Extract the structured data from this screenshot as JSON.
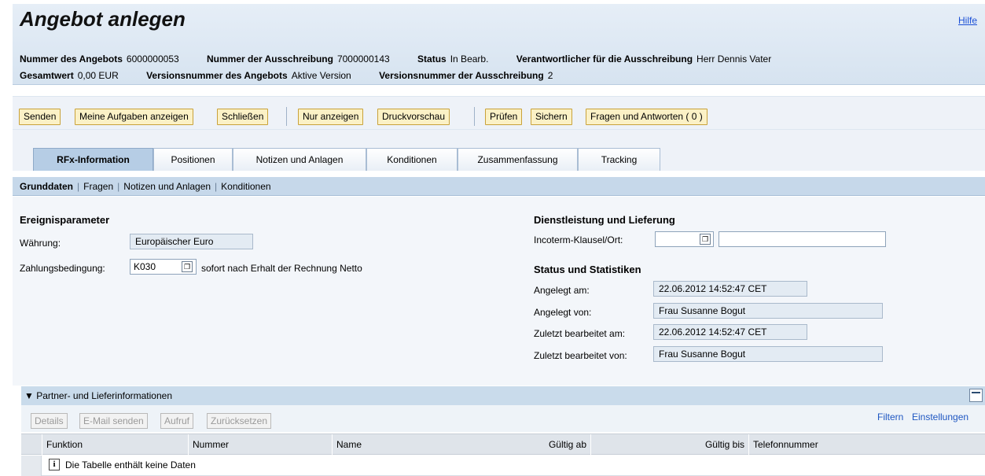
{
  "header": {
    "title": "Angebot anlegen",
    "help": "Hilfe",
    "row1": [
      {
        "label": "Nummer des Angebots",
        "value": "6000000053"
      },
      {
        "label": "Nummer der Ausschreibung",
        "value": "7000000143"
      },
      {
        "label": "Status",
        "value": "In Bearb."
      },
      {
        "label": "Verantwortlicher für die Ausschreibung",
        "value": "Herr Dennis Vater"
      }
    ],
    "row2": [
      {
        "label": "Gesamtwert",
        "value": "0,00 EUR"
      },
      {
        "label": "Versionsnummer des Angebots",
        "value": "Aktive Version"
      },
      {
        "label": "Versionsnummer der Ausschreibung",
        "value": "2"
      }
    ]
  },
  "toolbar": {
    "senden": "Senden",
    "aufgaben": "Meine Aufgaben anzeigen",
    "schliessen": "Schließen",
    "nur_anzeigen": "Nur anzeigen",
    "druckvorschau": "Druckvorschau",
    "pruefen": "Prüfen",
    "sichern": "Sichern",
    "fragen": "Fragen und Antworten ( 0 )"
  },
  "tabs": [
    {
      "label": "RFx-Information",
      "active": true
    },
    {
      "label": "Positionen"
    },
    {
      "label": "Notizen und Anlagen"
    },
    {
      "label": "Konditionen"
    },
    {
      "label": "Zusammenfassung"
    },
    {
      "label": "Tracking"
    }
  ],
  "subnav": [
    "Grunddaten",
    "Fragen",
    "Notizen und Anlagen",
    "Konditionen"
  ],
  "event": {
    "title": "Ereignisparameter",
    "currency_label": "Währung:",
    "currency_value": "Europäischer Euro",
    "payment_label": "Zahlungsbedingung:",
    "payment_value": "K030",
    "payment_text": "sofort nach Erhalt der Rechnung Netto"
  },
  "delivery": {
    "title": "Dienstleistung und Lieferung",
    "incoterm_label": "Incoterm-Klausel/Ort:",
    "incoterm_value": "",
    "location_value": ""
  },
  "stats": {
    "title": "Status und Statistiken",
    "created_on_label": "Angelegt am:",
    "created_on": "22.06.2012 14:52:47 CET",
    "created_by_label": "Angelegt von:",
    "created_by": "Frau Susanne Bogut",
    "changed_on_label": "Zuletzt bearbeitet am:",
    "changed_on": "22.06.2012 14:52:47 CET",
    "changed_by_label": "Zuletzt bearbeitet von:",
    "changed_by": "Frau Susanne Bogut"
  },
  "partner": {
    "title": "Partner- und Lieferinformationen",
    "buttons": {
      "details": "Details",
      "email": "E-Mail senden",
      "aufruf": "Aufruf",
      "reset": "Zurücksetzen"
    },
    "filter": "Filtern",
    "settings": "Einstellungen",
    "columns": [
      "Funktion",
      "Nummer",
      "Name",
      "Gültig ab",
      "Gültig bis",
      "Telefonnummer"
    ],
    "empty": "Die Tabelle enthält keine Daten"
  }
}
